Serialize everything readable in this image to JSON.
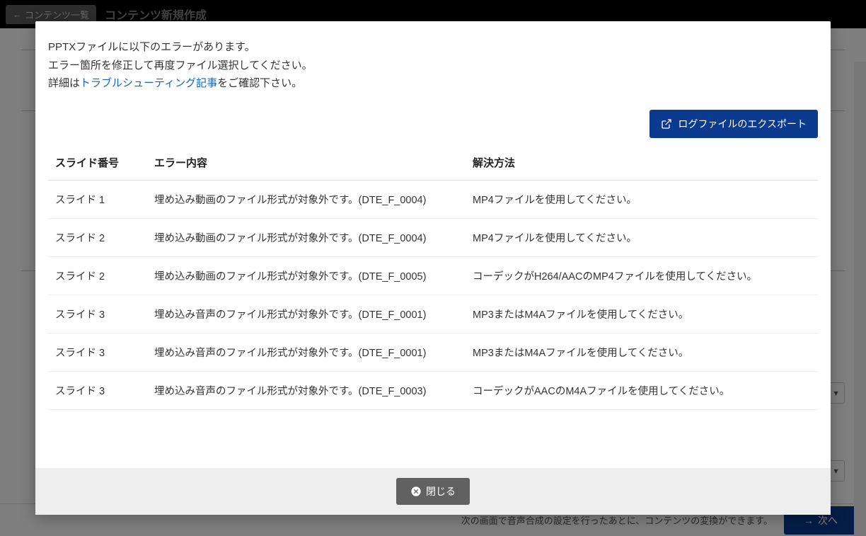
{
  "header": {
    "back_label": "コンテンツ一覧",
    "title": "コンテンツ新規作成"
  },
  "bg": {
    "footer_text": "次の画面で音声合成の設定を行ったあとに、コンテンツの変換ができます。",
    "next_label": "次へ"
  },
  "modal": {
    "msg_line1": "PPTXファイルに以下のエラーがあります。",
    "msg_line2": "エラー箇所を修正して再度ファイル選択してください。",
    "msg_line3_prefix": "詳細は",
    "msg_line3_link": "トラブルシューティング記事",
    "msg_line3_suffix": "をご確認下さい。",
    "export_label": "ログファイルのエクスポート",
    "close_label": "閉じる",
    "columns": {
      "slide": "スライド番号",
      "error": "エラー内容",
      "solution": "解決方法"
    },
    "rows": [
      {
        "slide": "スライド 1",
        "error": "埋め込み動画のファイル形式が対象外です。(DTE_F_0004)",
        "solution": "MP4ファイルを使用してください。"
      },
      {
        "slide": "スライド 2",
        "error": "埋め込み動画のファイル形式が対象外です。(DTE_F_0004)",
        "solution": "MP4ファイルを使用してください。"
      },
      {
        "slide": "スライド 2",
        "error": "埋め込み動画のファイル形式が対象外です。(DTE_F_0005)",
        "solution": "コーデックがH264/AACのMP4ファイルを使用してください。"
      },
      {
        "slide": "スライド 3",
        "error": "埋め込み音声のファイル形式が対象外です。(DTE_F_0001)",
        "solution": "MP3またはM4Aファイルを使用してください。"
      },
      {
        "slide": "スライド 3",
        "error": "埋め込み音声のファイル形式が対象外です。(DTE_F_0001)",
        "solution": "MP3またはM4Aファイルを使用してください。"
      },
      {
        "slide": "スライド 3",
        "error": "埋め込み音声のファイル形式が対象外です。(DTE_F_0003)",
        "solution": "コーデックがAACのM4Aファイルを使用してください。"
      }
    ]
  }
}
